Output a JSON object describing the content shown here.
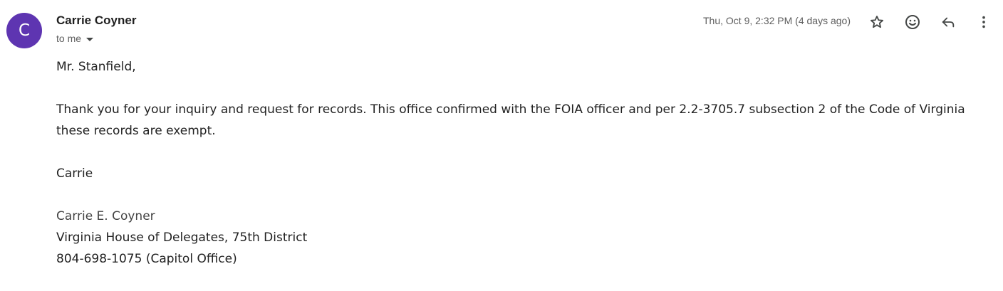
{
  "sender": {
    "avatar_letter": "C",
    "name": "Carrie Coyner",
    "recipient_label": "to me"
  },
  "header": {
    "timestamp": "Thu, Oct 9, 2:32 PM (4 days ago)",
    "icons": [
      "star-icon",
      "emoji-icon",
      "reply-icon",
      "more-vert-icon"
    ]
  },
  "message": {
    "greeting": "Mr. Stanfield,",
    "paragraph_1": "Thank you for your inquiry and request for records.  This office confirmed with the FOIA officer and per 2.2-3705.7 subsection 2 of the Code of Virginia these records are exempt.",
    "closing": "Carrie",
    "signature": {
      "name": "Carrie E. Coyner",
      "title": "Virginia House of Delegates, 75th District",
      "phone": "804-698-1075 (Capitol Office)"
    }
  },
  "colors": {
    "avatar": "#5e35b1",
    "text": "#1f1f1f",
    "secondary_text": "#5e5e5e",
    "icon": "#444746"
  }
}
